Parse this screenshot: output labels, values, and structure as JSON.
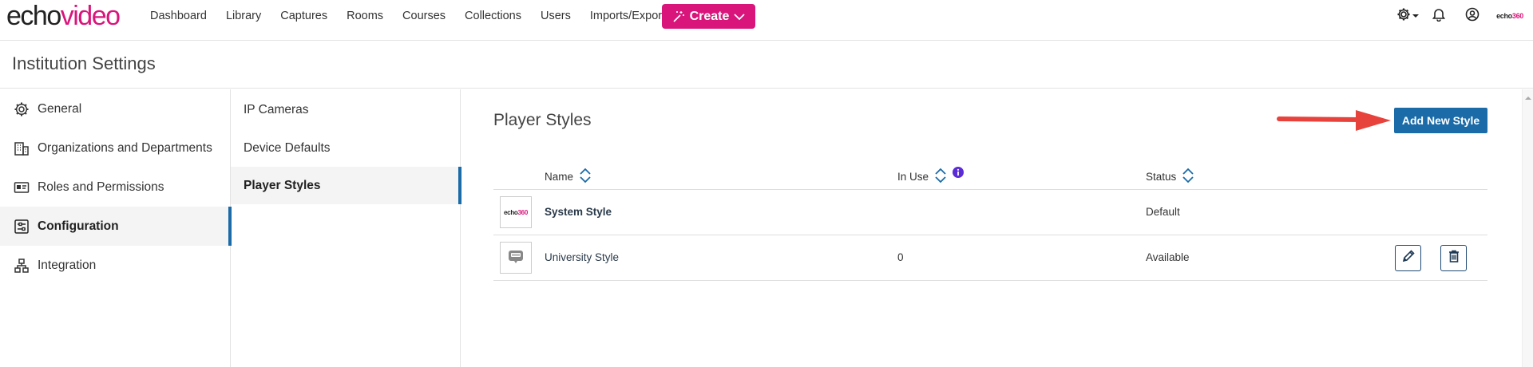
{
  "app": {
    "logo_part1": "echo",
    "logo_part2": "video",
    "nav": [
      "Dashboard",
      "Library",
      "Captures",
      "Rooms",
      "Courses",
      "Collections",
      "Users",
      "Imports/Exports"
    ],
    "create_label": "Create",
    "user_logo_part1": "echo",
    "user_logo_part2": "360"
  },
  "page": {
    "title": "Institution Settings"
  },
  "sidebar": {
    "items": [
      {
        "label": "General",
        "icon": "gear-icon"
      },
      {
        "label": "Organizations and Departments",
        "icon": "building-icon"
      },
      {
        "label": "Roles and Permissions",
        "icon": "id-card-icon"
      },
      {
        "label": "Configuration",
        "icon": "sliders-icon",
        "active": true
      },
      {
        "label": "Integration",
        "icon": "network-icon"
      }
    ]
  },
  "subnav": {
    "items": [
      {
        "label": "IP Cameras"
      },
      {
        "label": "Device Defaults"
      },
      {
        "label": "Player Styles",
        "active": true
      }
    ]
  },
  "main": {
    "title": "Player Styles",
    "add_button": "Add New Style",
    "columns": [
      "Name",
      "In Use",
      "Status"
    ],
    "rows": [
      {
        "thumb_text_1": "echo",
        "thumb_text_2": "360",
        "name": "System Style",
        "in_use": "",
        "status": "Default"
      },
      {
        "name": "University Style",
        "in_use": "0",
        "status": "Available"
      }
    ]
  },
  "colors": {
    "brand_pink": "#d9157b",
    "accent_blue": "#1a6ba8",
    "annotation_red": "#e8423c"
  }
}
